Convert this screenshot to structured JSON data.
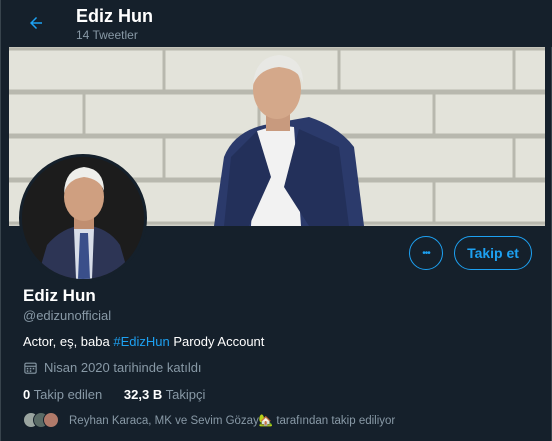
{
  "header": {
    "name": "Ediz Hun",
    "tweet_count": "14 Tweetler"
  },
  "profile": {
    "name": "Ediz Hun",
    "handle": "@edizunofficial",
    "bio_prefix": "Actor, eş, baba ",
    "bio_hashtag": "#EdizHun",
    "bio_suffix": " Parody Account",
    "joined": "Nisan 2020 tarihinde katıldı",
    "following_count": "0",
    "following_label": " Takip edilen",
    "followers_count": "32,3 B",
    "followers_label": " Takipçi",
    "followed_by": "Reyhan Karaca, MK ve Sevim Gözay🏡 tarafından takip ediliyor"
  },
  "actions": {
    "follow_label": "Takip et",
    "more_label": "•••"
  },
  "colors": {
    "background": "#15202b",
    "accent": "#1da1f2",
    "secondary_text": "#8899a6"
  },
  "icons": {
    "back": "arrow-left-icon",
    "calendar": "calendar-icon",
    "more": "more-horizontal-icon"
  }
}
